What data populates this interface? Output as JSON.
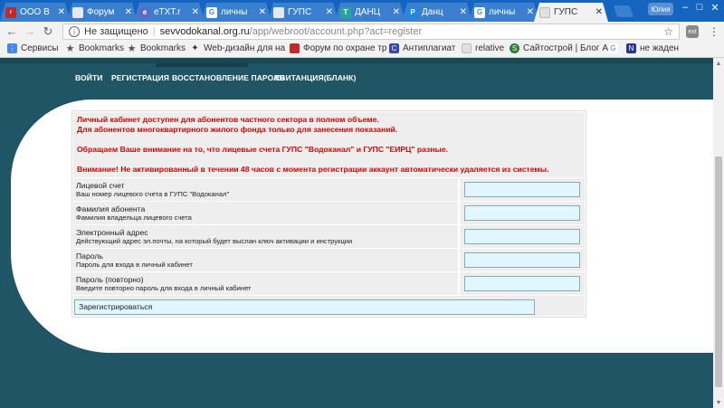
{
  "browser": {
    "tabs": [
      {
        "label": "ООО В",
        "favicon": "rabota-favicon",
        "color": "#c62828",
        "icon_text": "r"
      },
      {
        "label": "Форум",
        "favicon": "page-icon",
        "color": "#eeeeee",
        "icon_text": ""
      },
      {
        "label": "eTXT.r",
        "favicon": "etxt-icon",
        "color": "#5c6bc0",
        "icon_text": "e"
      },
      {
        "label": "личны",
        "favicon": "google-icon",
        "color": "#ffffff",
        "icon_text": "G"
      },
      {
        "label": "ГУПС",
        "favicon": "page-icon",
        "color": "#eeeeee",
        "icon_text": ""
      },
      {
        "label": "ДАНЦ",
        "favicon": "t-icon",
        "color": "#26a69a",
        "icon_text": "T"
      },
      {
        "label": "Данц",
        "favicon": "p-icon",
        "color": "#1e88e5",
        "icon_text": "P"
      },
      {
        "label": "личны",
        "favicon": "google-icon",
        "color": "#ffffff",
        "icon_text": "G"
      },
      {
        "label": "ГУПС",
        "favicon": "page-icon",
        "color": "#eeeeee",
        "icon_text": "",
        "active": true
      }
    ],
    "user_label": "Юлия",
    "address": {
      "security": "Не защищено",
      "host": "sevvodokanal.org.ru",
      "path": "/app/webroot/account.php?act=register"
    },
    "bookmarks": [
      {
        "label": "Сервисы",
        "icon": "apps-icon",
        "color": "#4285f4"
      },
      {
        "label": "Bookmarks",
        "icon": "star-icon",
        "color": "#555555"
      },
      {
        "label": "Bookmarks",
        "icon": "star-icon",
        "color": "#555555"
      },
      {
        "label": "Web-дизайн для на",
        "icon": "folder-icon",
        "color": "#333333"
      },
      {
        "label": "Форум по охране тр",
        "icon": "page-icon",
        "color": "#c62828"
      },
      {
        "label": "Антиплагиат",
        "icon": "c-icon",
        "color": "#3949ab"
      },
      {
        "label": "relative",
        "icon": "page-icon",
        "color": "#dddddd"
      },
      {
        "label": "Сайтострой | Блог А",
        "icon": "s-icon",
        "color": "#2e7d32"
      },
      {
        "label": "",
        "icon": "g-icon",
        "color": "#4285f4"
      },
      {
        "label": "не жаден",
        "icon": "n-icon",
        "color": "#283593"
      }
    ]
  },
  "nav": {
    "login": "ВОЙТИ",
    "register": "РЕГИСТРАЦИЯ",
    "restore": "ВОССТАНОВЛЕНИЕ ПАРОЛЯ",
    "receipt": "КВИТАНЦИЯ(БЛАНК)"
  },
  "notice": {
    "line1": "Личный кабинет доступен для абонентов частного сектора в полном объеме.",
    "line2": "Для абонентов многоквартирного жилого фонда только для занесения показаний.",
    "line3": "Обращаем Ваше внимание на то, что лицевые счета ГУПС \"Водоканал\" и ГУПС \"ЕИРЦ\" разные.",
    "line4": "Внимание! Не активированный в течении 48 часов с момента регистрации аккаунт автоматически удаляется из системы."
  },
  "fields": [
    {
      "label": "Лицевой счет",
      "hint": "Ваш номер лицевого счета в ГУПС \"Водоканал\"",
      "value": ""
    },
    {
      "label": "Фамилия абонента",
      "hint": "Фамилия владельца лицевого счета",
      "value": ""
    },
    {
      "label": "Электронный адрес",
      "hint": "Действующий адрес эл.почты, на который будет выслан ключ активации и инструкции",
      "value": ""
    },
    {
      "label": "Пароль",
      "hint": "Пароль для входа в личный кабинет",
      "value": ""
    },
    {
      "label": "Пароль (повторно)",
      "hint": "Введите повторно пароль для входа в личный кабинет",
      "value": ""
    }
  ],
  "submit": {
    "label": "Зарегистрироваться"
  },
  "colors": {
    "accent_text": "#e00000",
    "page_bg": "#1f5564",
    "input_bg": "#e0f7ff"
  }
}
